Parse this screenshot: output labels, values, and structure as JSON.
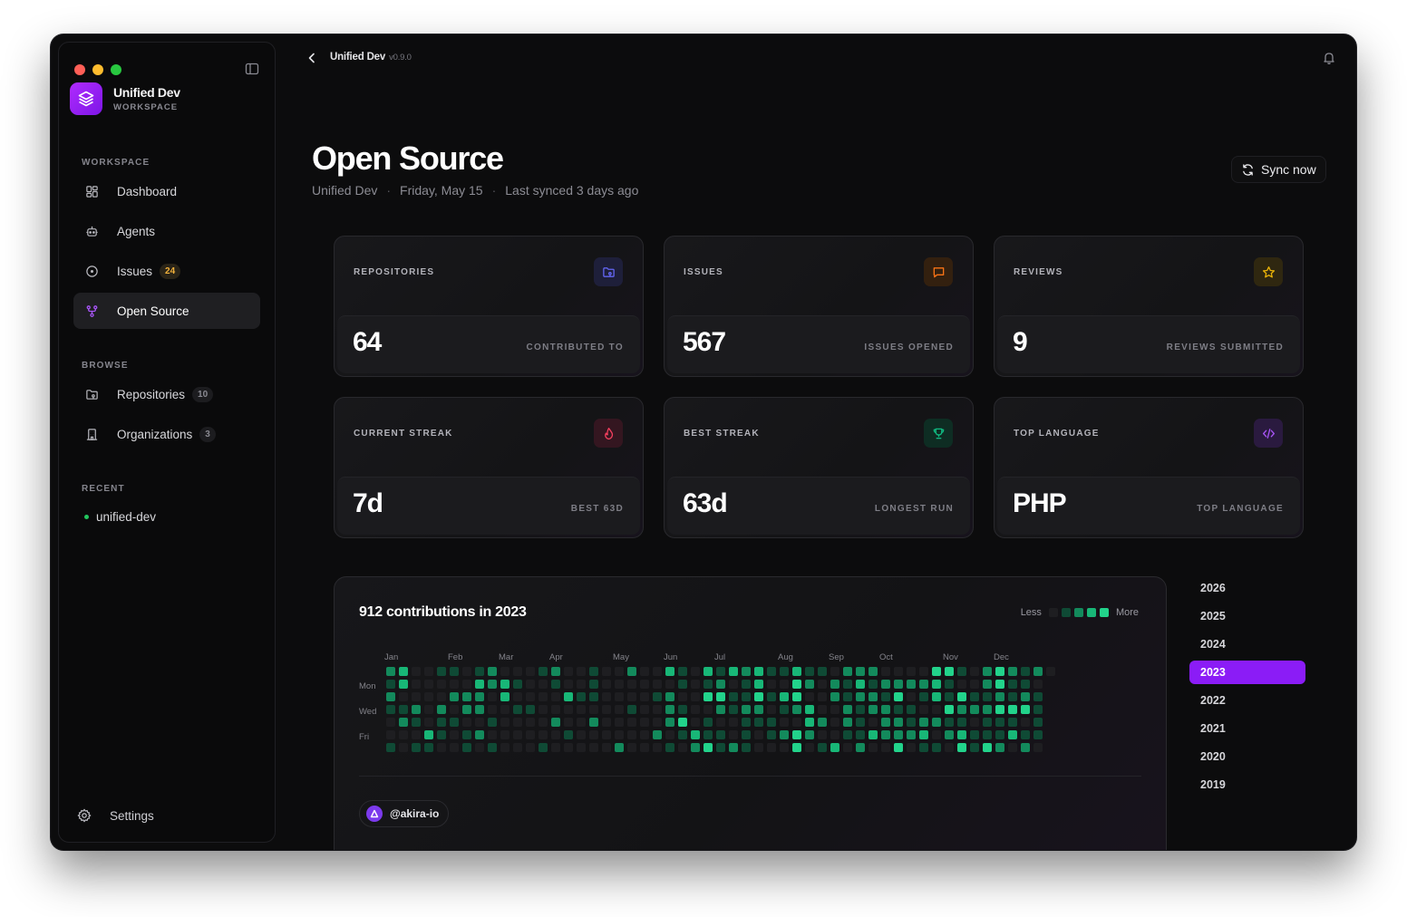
{
  "app": {
    "name": "Unified Dev",
    "workspace_label": "WORKSPACE",
    "version": "v0.9.0"
  },
  "sidebar": {
    "sections": {
      "workspace": "WORKSPACE",
      "browse": "BROWSE",
      "recent": "RECENT"
    },
    "workspace_items": [
      {
        "label": "Dashboard",
        "icon": "dashboard-icon"
      },
      {
        "label": "Agents",
        "icon": "bot-icon"
      },
      {
        "label": "Issues",
        "icon": "issue-icon",
        "badge": "24"
      },
      {
        "label": "Open Source",
        "icon": "git-fork-icon",
        "active": true
      }
    ],
    "browse_items": [
      {
        "label": "Repositories",
        "icon": "folder-git-icon",
        "badge": "10"
      },
      {
        "label": "Organizations",
        "icon": "building-icon",
        "badge": "3"
      }
    ],
    "recent_items": [
      {
        "label": "unified-dev"
      }
    ],
    "settings_label": "Settings"
  },
  "header": {
    "title": "Open Source",
    "subtitle": [
      "Unified Dev",
      "Friday, May 15",
      "Last synced 3 days ago"
    ],
    "separator": "·",
    "sync_label": "Sync now"
  },
  "cards": [
    {
      "label": "REPOSITORIES",
      "value": "64",
      "caption": "CONTRIBUTED TO",
      "icon": "folder-git-icon",
      "accent": "#6366f1"
    },
    {
      "label": "ISSUES",
      "value": "567",
      "caption": "ISSUES OPENED",
      "icon": "message-square-icon",
      "accent": "#f97316"
    },
    {
      "label": "REVIEWS",
      "value": "9",
      "caption": "REVIEWS SUBMITTED",
      "icon": "star-icon",
      "accent": "#eab308"
    },
    {
      "label": "CURRENT STREAK",
      "value": "7d",
      "caption": "BEST 63D",
      "icon": "flame-icon",
      "accent": "#f43f5e"
    },
    {
      "label": "BEST STREAK",
      "value": "63d",
      "caption": "LONGEST RUN",
      "icon": "trophy-icon",
      "accent": "#10b981"
    },
    {
      "label": "TOP LANGUAGE",
      "value": "PHP",
      "caption": "TOP LANGUAGE",
      "icon": "code-icon",
      "accent": "#a855f7"
    }
  ],
  "contributions": {
    "title": "912 contributions in 2023",
    "legend_less": "Less",
    "legend_more": "More",
    "months": [
      "Jan",
      "Feb",
      "Mar",
      "Apr",
      "May",
      "Jun",
      "Jul",
      "Aug",
      "Sep",
      "Oct",
      "Nov",
      "Dec"
    ],
    "days": [
      "Mon",
      "Wed",
      "Fri"
    ],
    "username": "@akira-io",
    "colors": [
      "#1e1e21",
      "#0f4a35",
      "#138a5c",
      "#18b777",
      "#22d38b"
    ]
  },
  "years": [
    "2026",
    "2025",
    "2024",
    "2023",
    "2022",
    "2021",
    "2020",
    "2019"
  ],
  "selected_year": "2023"
}
